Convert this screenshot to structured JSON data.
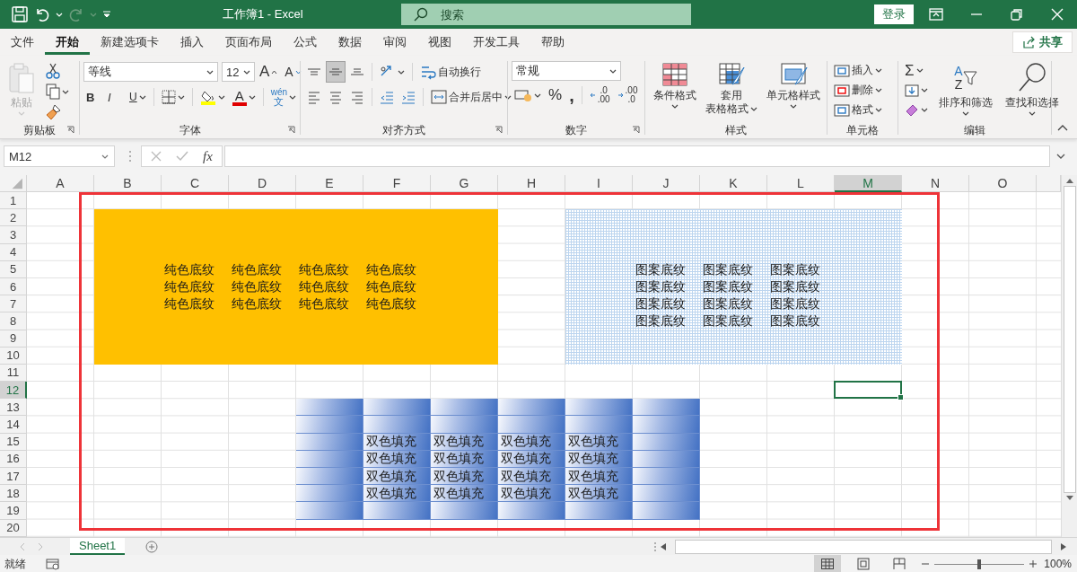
{
  "title_bar": {
    "title": "工作簿1 - Excel",
    "redo_disabled": true,
    "search": {
      "placeholder": "搜索"
    },
    "sign_in": "登录"
  },
  "menu_tabs": [
    {
      "label": "文件",
      "selected": false
    },
    {
      "label": "开始",
      "selected": true
    },
    {
      "label": "新建选项卡",
      "selected": false
    },
    {
      "label": "插入",
      "selected": false
    },
    {
      "label": "页面布局",
      "selected": false
    },
    {
      "label": "公式",
      "selected": false
    },
    {
      "label": "数据",
      "selected": false
    },
    {
      "label": "审阅",
      "selected": false
    },
    {
      "label": "视图",
      "selected": false
    },
    {
      "label": "开发工具",
      "selected": false
    },
    {
      "label": "帮助",
      "selected": false
    }
  ],
  "share": "共享",
  "ribbon": {
    "groups": [
      {
        "kind": "clipboard",
        "label": "剪贴板",
        "paste": "粘贴",
        "paste_disabled": true
      },
      {
        "kind": "font",
        "label": "字体",
        "font_name": "等线",
        "font_size": "12",
        "grow": "A",
        "shrink": "A",
        "bold": "B",
        "italic": "I",
        "underline": "U",
        "font_color": "A",
        "phonetic": [
          "wén",
          "文"
        ]
      },
      {
        "kind": "alignment",
        "label": "对齐方式",
        "vertical_align": [
          {
            "selected": false
          },
          {
            "selected": true
          },
          {
            "selected": false
          }
        ],
        "wrap_text": "自动换行",
        "merge": "合并后居中"
      },
      {
        "kind": "number",
        "label": "数字",
        "format": "常规",
        "percent": "%",
        "comma": ",",
        "increase_decimal": [
          ".0",
          ".00"
        ],
        "decrease_decimal": [
          ".00",
          ".0"
        ]
      },
      {
        "kind": "styles",
        "label": "样式",
        "buttons": [
          [
            "条件格式"
          ],
          [
            "套用",
            "表格格式"
          ],
          [
            "单元格样式"
          ]
        ]
      },
      {
        "kind": "cells",
        "label": "单元格",
        "buttons": [
          "插入",
          "删除",
          "格式"
        ]
      },
      {
        "kind": "editing",
        "label": "编辑",
        "autosum": "Σ",
        "sort_letters": [
          "A",
          "Z"
        ],
        "sort": "排序和筛选",
        "find": "查找和选择"
      }
    ]
  },
  "formula_bar": {
    "name_box": "M12",
    "fx": "fx"
  },
  "sheet": {
    "columns": [
      {
        "label": "A",
        "selected": false
      },
      {
        "label": "B",
        "selected": false
      },
      {
        "label": "C",
        "selected": false
      },
      {
        "label": "D",
        "selected": false
      },
      {
        "label": "E",
        "selected": false
      },
      {
        "label": "F",
        "selected": false
      },
      {
        "label": "G",
        "selected": false
      },
      {
        "label": "H",
        "selected": false
      },
      {
        "label": "I",
        "selected": false
      },
      {
        "label": "J",
        "selected": false
      },
      {
        "label": "K",
        "selected": false
      },
      {
        "label": "L",
        "selected": false
      },
      {
        "label": "M",
        "selected": true
      },
      {
        "label": "N",
        "selected": false
      },
      {
        "label": "O",
        "selected": false
      }
    ],
    "rows": [
      {
        "label": "1",
        "selected": false
      },
      {
        "label": "2",
        "selected": false,
        "cells": [
          {
            "kind": "none"
          },
          {
            "kind": "solid"
          },
          {
            "kind": "solid"
          },
          {
            "kind": "solid"
          },
          {
            "kind": "solid"
          },
          {
            "kind": "solid"
          },
          {
            "kind": "solid"
          },
          {
            "kind": "none"
          },
          {
            "kind": "pattern"
          },
          {
            "kind": "pattern"
          },
          {
            "kind": "pattern"
          },
          {
            "kind": "pattern"
          },
          {
            "kind": "pattern"
          }
        ]
      },
      {
        "label": "3",
        "selected": false,
        "cells": [
          {
            "kind": "none"
          },
          {
            "kind": "solid"
          },
          {
            "kind": "solid"
          },
          {
            "kind": "solid"
          },
          {
            "kind": "solid"
          },
          {
            "kind": "solid"
          },
          {
            "kind": "solid"
          },
          {
            "kind": "none"
          },
          {
            "kind": "pattern"
          },
          {
            "kind": "pattern"
          },
          {
            "kind": "pattern"
          },
          {
            "kind": "pattern"
          },
          {
            "kind": "pattern"
          }
        ]
      },
      {
        "label": "4",
        "selected": false,
        "cells": [
          {
            "kind": "none"
          },
          {
            "kind": "solid"
          },
          {
            "kind": "solid"
          },
          {
            "kind": "solid"
          },
          {
            "kind": "solid"
          },
          {
            "kind": "solid"
          },
          {
            "kind": "solid"
          },
          {
            "kind": "none"
          },
          {
            "kind": "pattern"
          },
          {
            "kind": "pattern"
          },
          {
            "kind": "pattern"
          },
          {
            "kind": "pattern"
          },
          {
            "kind": "pattern"
          }
        ]
      },
      {
        "label": "5",
        "selected": false,
        "cells": [
          {
            "kind": "none"
          },
          {
            "kind": "solid"
          },
          {
            "kind": "solid",
            "text": "纯色底纹"
          },
          {
            "kind": "solid",
            "text": "纯色底纹"
          },
          {
            "kind": "solid",
            "text": "纯色底纹"
          },
          {
            "kind": "solid",
            "text": "纯色底纹"
          },
          {
            "kind": "solid"
          },
          {
            "kind": "none"
          },
          {
            "kind": "pattern"
          },
          {
            "kind": "pattern",
            "text": "图案底纹"
          },
          {
            "kind": "pattern",
            "text": "图案底纹"
          },
          {
            "kind": "pattern",
            "text": "图案底纹"
          },
          {
            "kind": "pattern"
          }
        ]
      },
      {
        "label": "6",
        "selected": false,
        "cells": [
          {
            "kind": "none"
          },
          {
            "kind": "solid"
          },
          {
            "kind": "solid",
            "text": "纯色底纹"
          },
          {
            "kind": "solid",
            "text": "纯色底纹"
          },
          {
            "kind": "solid",
            "text": "纯色底纹"
          },
          {
            "kind": "solid",
            "text": "纯色底纹"
          },
          {
            "kind": "solid"
          },
          {
            "kind": "none"
          },
          {
            "kind": "pattern"
          },
          {
            "kind": "pattern",
            "text": "图案底纹"
          },
          {
            "kind": "pattern",
            "text": "图案底纹"
          },
          {
            "kind": "pattern",
            "text": "图案底纹"
          },
          {
            "kind": "pattern"
          }
        ]
      },
      {
        "label": "7",
        "selected": false,
        "cells": [
          {
            "kind": "none"
          },
          {
            "kind": "solid"
          },
          {
            "kind": "solid",
            "text": "纯色底纹"
          },
          {
            "kind": "solid",
            "text": "纯色底纹"
          },
          {
            "kind": "solid",
            "text": "纯色底纹"
          },
          {
            "kind": "solid",
            "text": "纯色底纹"
          },
          {
            "kind": "solid"
          },
          {
            "kind": "none"
          },
          {
            "kind": "pattern"
          },
          {
            "kind": "pattern",
            "text": "图案底纹"
          },
          {
            "kind": "pattern",
            "text": "图案底纹"
          },
          {
            "kind": "pattern",
            "text": "图案底纹"
          },
          {
            "kind": "pattern"
          }
        ]
      },
      {
        "label": "8",
        "selected": false,
        "cells": [
          {
            "kind": "none"
          },
          {
            "kind": "solid"
          },
          {
            "kind": "solid"
          },
          {
            "kind": "solid"
          },
          {
            "kind": "solid"
          },
          {
            "kind": "solid"
          },
          {
            "kind": "solid"
          },
          {
            "kind": "none"
          },
          {
            "kind": "pattern"
          },
          {
            "kind": "pattern",
            "text": "图案底纹"
          },
          {
            "kind": "pattern",
            "text": "图案底纹"
          },
          {
            "kind": "pattern",
            "text": "图案底纹"
          },
          {
            "kind": "pattern"
          }
        ]
      },
      {
        "label": "9",
        "selected": false,
        "cells": [
          {
            "kind": "none"
          },
          {
            "kind": "solid"
          },
          {
            "kind": "solid"
          },
          {
            "kind": "solid"
          },
          {
            "kind": "solid"
          },
          {
            "kind": "solid"
          },
          {
            "kind": "solid"
          },
          {
            "kind": "none"
          },
          {
            "kind": "pattern"
          },
          {
            "kind": "pattern"
          },
          {
            "kind": "pattern"
          },
          {
            "kind": "pattern"
          },
          {
            "kind": "pattern"
          }
        ]
      },
      {
        "label": "10",
        "selected": false,
        "cells": [
          {
            "kind": "none"
          },
          {
            "kind": "solid"
          },
          {
            "kind": "solid"
          },
          {
            "kind": "solid"
          },
          {
            "kind": "solid"
          },
          {
            "kind": "solid"
          },
          {
            "kind": "solid"
          },
          {
            "kind": "none"
          },
          {
            "kind": "pattern"
          },
          {
            "kind": "pattern"
          },
          {
            "kind": "pattern"
          },
          {
            "kind": "pattern"
          },
          {
            "kind": "pattern"
          }
        ]
      },
      {
        "label": "11",
        "selected": false
      },
      {
        "label": "12",
        "selected": true
      },
      {
        "label": "13",
        "selected": false,
        "cells": [
          {
            "kind": "none"
          },
          {
            "kind": "none"
          },
          {
            "kind": "none"
          },
          {
            "kind": "none"
          },
          {
            "kind": "gradient"
          },
          {
            "kind": "gradient"
          },
          {
            "kind": "gradient"
          },
          {
            "kind": "gradient"
          },
          {
            "kind": "gradient"
          },
          {
            "kind": "gradient"
          }
        ]
      },
      {
        "label": "14",
        "selected": false,
        "cells": [
          {
            "kind": "none"
          },
          {
            "kind": "none"
          },
          {
            "kind": "none"
          },
          {
            "kind": "none"
          },
          {
            "kind": "gradient"
          },
          {
            "kind": "gradient"
          },
          {
            "kind": "gradient"
          },
          {
            "kind": "gradient"
          },
          {
            "kind": "gradient"
          },
          {
            "kind": "gradient"
          }
        ]
      },
      {
        "label": "15",
        "selected": false,
        "cells": [
          {
            "kind": "none"
          },
          {
            "kind": "none"
          },
          {
            "kind": "none"
          },
          {
            "kind": "none"
          },
          {
            "kind": "gradient"
          },
          {
            "kind": "gradient",
            "text": "双色填充"
          },
          {
            "kind": "gradient",
            "text": "双色填充"
          },
          {
            "kind": "gradient",
            "text": "双色填充"
          },
          {
            "kind": "gradient",
            "text": "双色填充"
          },
          {
            "kind": "gradient"
          }
        ]
      },
      {
        "label": "16",
        "selected": false,
        "cells": [
          {
            "kind": "none"
          },
          {
            "kind": "none"
          },
          {
            "kind": "none"
          },
          {
            "kind": "none"
          },
          {
            "kind": "gradient"
          },
          {
            "kind": "gradient",
            "text": "双色填充"
          },
          {
            "kind": "gradient",
            "text": "双色填充"
          },
          {
            "kind": "gradient",
            "text": "双色填充"
          },
          {
            "kind": "gradient",
            "text": "双色填充"
          },
          {
            "kind": "gradient"
          }
        ]
      },
      {
        "label": "17",
        "selected": false,
        "cells": [
          {
            "kind": "none"
          },
          {
            "kind": "none"
          },
          {
            "kind": "none"
          },
          {
            "kind": "none"
          },
          {
            "kind": "gradient"
          },
          {
            "kind": "gradient",
            "text": "双色填充"
          },
          {
            "kind": "gradient",
            "text": "双色填充"
          },
          {
            "kind": "gradient",
            "text": "双色填充"
          },
          {
            "kind": "gradient",
            "text": "双色填充"
          },
          {
            "kind": "gradient"
          }
        ]
      },
      {
        "label": "18",
        "selected": false,
        "cells": [
          {
            "kind": "none"
          },
          {
            "kind": "none"
          },
          {
            "kind": "none"
          },
          {
            "kind": "none"
          },
          {
            "kind": "gradient"
          },
          {
            "kind": "gradient",
            "text": "双色填充"
          },
          {
            "kind": "gradient",
            "text": "双色填充"
          },
          {
            "kind": "gradient",
            "text": "双色填充"
          },
          {
            "kind": "gradient",
            "text": "双色填充"
          },
          {
            "kind": "gradient"
          }
        ]
      },
      {
        "label": "19",
        "selected": false,
        "cells": [
          {
            "kind": "none"
          },
          {
            "kind": "none"
          },
          {
            "kind": "none"
          },
          {
            "kind": "none"
          },
          {
            "kind": "gradient"
          },
          {
            "kind": "gradient"
          },
          {
            "kind": "gradient"
          },
          {
            "kind": "gradient"
          },
          {
            "kind": "gradient"
          },
          {
            "kind": "gradient"
          }
        ]
      },
      {
        "label": "20",
        "selected": false
      }
    ]
  },
  "sheet_tabs": [
    {
      "label": "Sheet1",
      "selected": true
    }
  ],
  "status_bar": {
    "status": "就绪",
    "zoom_slider": {
      "level": 0.5
    },
    "zoom": "100%"
  }
}
